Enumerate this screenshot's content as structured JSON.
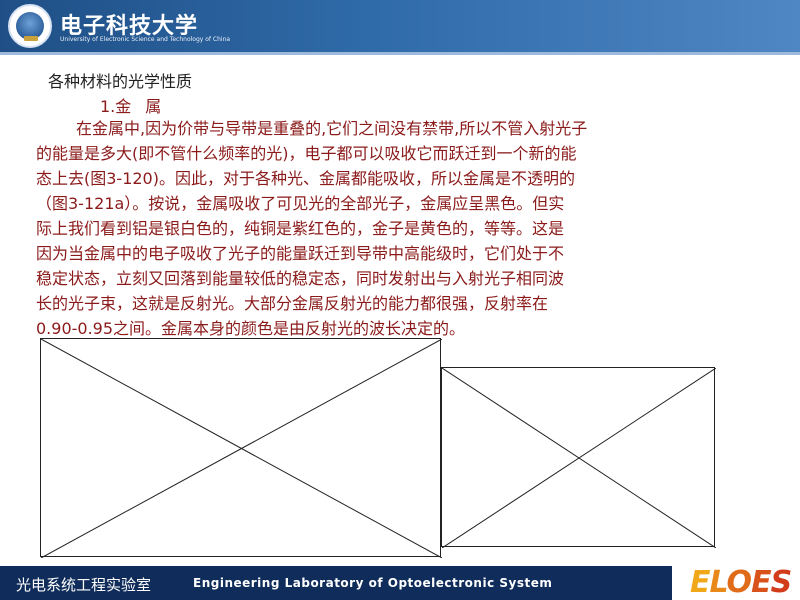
{
  "header": {
    "university_cn": "电子科技大学",
    "university_en": "University of Electronic Science and Technology of China"
  },
  "content": {
    "heading": "各种材料的光学性质",
    "subheading_num": "1.金",
    "subheading_word": "属",
    "paragraph_lines": [
      "在金属中,因为价带与导带是重叠的,它们之间没有禁带,所以不管入射光子",
      "的能量是多大(即不管什么频率的光)，电子都可以吸收它而跃迁到一个新的能",
      "态上去(图3-120)。因此，对于各种光、金属都能吸收，所以金属是不透明的",
      "（图3-121a）。按说，金属吸收了可见光的全部光子，金属应呈黑色。但实",
      "际上我们看到铝是银白色的，纯铜是紫红色的，金子是黄色的，等等。这是",
      "因为当金属中的电子吸收了光子的能量跃迁到导带中高能级时，它们处于不",
      "稳定状态，立刻又回落到能量较低的稳定态，同时发射出与入射光子相同波",
      "长的光子束，这就是反射光。大部分金属反射光的能力都很强，反射率在",
      "0.90-0.95之间。金属本身的颜色是由反射光的波长决定的。"
    ]
  },
  "footer": {
    "lab_cn": "光电系统工程实验室",
    "lab_en": "Engineering Laboratory of Optoelectronic System",
    "brand_letters": [
      "E",
      "L",
      "O",
      "E",
      "S"
    ]
  },
  "colors": {
    "header_blue": "#1f4f86",
    "text_red": "#8b1a1a",
    "footer_navy": "#0f2c5a"
  }
}
